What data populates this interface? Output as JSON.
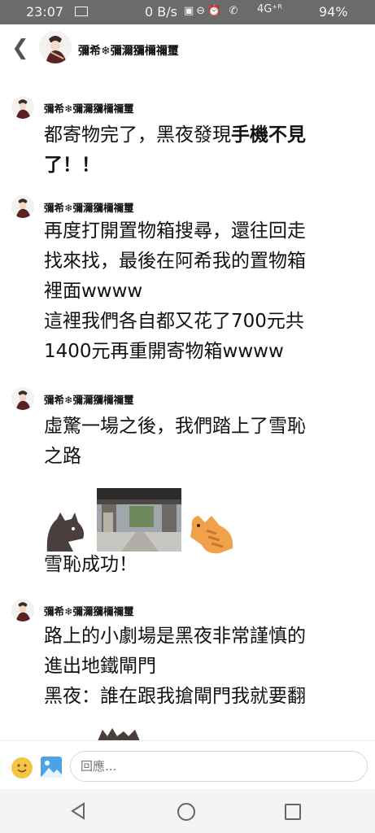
{
  "status": {
    "time": "23:07",
    "net_speed": "0 B/s",
    "signal": "4G⁺ᴿ",
    "battery": "94%"
  },
  "header": {
    "author": "彌希❄彌濔獼檷禰璽"
  },
  "messages": [
    {
      "author": "彌希❄彌濔獼檷禰璽",
      "line1_a": "都寄物完了，黑夜發現",
      "line1_b": "手機不見",
      "line2": "了！！"
    },
    {
      "author": "彌希❄彌濔獼檷禰璽",
      "lines": [
        "再度打開置物箱搜尋，還往回走",
        "找來找，最後在阿希我的置物箱",
        "裡面wwww",
        "這裡我們各自都又花了700元共",
        "1400元再重開寄物箱wwww"
      ]
    },
    {
      "author": "彌希❄彌濔獼檷禰璽",
      "lines": [
        "虛驚一場之後，我們踏上了雪恥",
        "之路"
      ],
      "after_stickers": "雪恥成功！"
    },
    {
      "author": "彌希❄彌濔獼檷禰璽",
      "lines": [
        "路上的小劇場是黑夜非常謹慎的",
        "進出地鐵閘門",
        "黑夜：誰在跟我搶閘門我就要翻"
      ]
    }
  ],
  "stickers": {
    "left": "black-cat-sticker",
    "photo": "temple-gate-photo",
    "right": "orange-cat-sticker"
  },
  "reply": {
    "placeholder": "回應..."
  },
  "colors": {
    "status_bar": "#6b6b6b",
    "emoji": "#f6c445",
    "image_button": "#4aa3e6",
    "orange_cat": "#f0a24a",
    "black_cat": "#4a3f3d"
  }
}
